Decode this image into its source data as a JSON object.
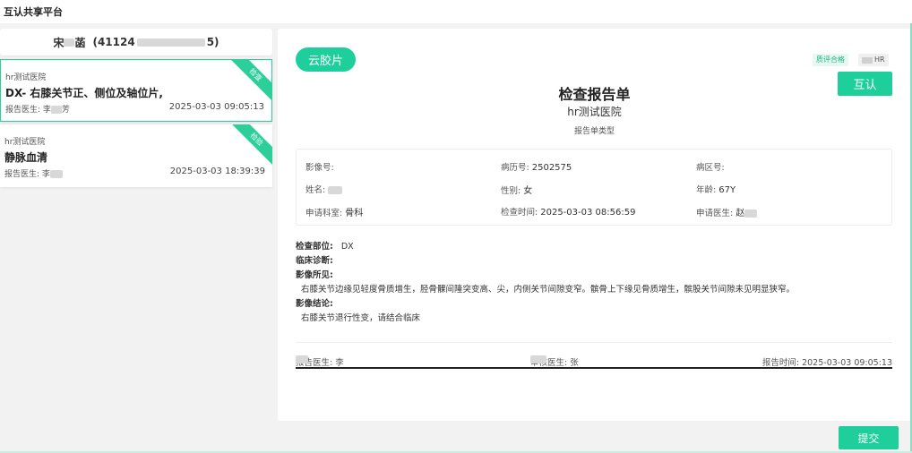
{
  "app": {
    "title": "互认共享平台"
  },
  "patient": {
    "name_prefix": "宋",
    "name_suffix": "菡",
    "id_prefix": "(41124",
    "id_suffix": "5)"
  },
  "cards": [
    {
      "hospital": "hr测试医院",
      "name": "DX- 右膝关节正、侧位及轴位片,",
      "doctor_label": "报告医生: 李",
      "doctor_suffix": "芳",
      "time": "2025-03-03 09:05:13",
      "badge": "检查"
    },
    {
      "hospital": "hr测试医院",
      "name": "静脉血清",
      "doctor_label": "报告医生: 李",
      "doctor_suffix": "",
      "time": "2025-03-03 18:39:39",
      "badge": "检验"
    }
  ],
  "report": {
    "film_button": "云胶片",
    "tag_pass": "质评合格",
    "tag_hr": "HR",
    "mutual_button": "互认",
    "title": "检查报告单",
    "hospital": "hr测试医院",
    "type": "报告单类型",
    "info": {
      "image_no": "影像号:",
      "record_no_label": "病历号:",
      "record_no": "2502575",
      "ward_no": "病区号:",
      "name_label": "姓名:",
      "gender_label": "性别:",
      "gender": "女",
      "age_label": "年龄:",
      "age": "67Y",
      "dept_label": "申请科室:",
      "dept": "骨科",
      "exam_time_label": "检查时间:",
      "exam_time": "2025-03-03 08:56:59",
      "req_doctor_label": "申请医生:",
      "req_doctor": "赵"
    },
    "findings": {
      "part_label": "检查部位:",
      "part": "DX",
      "clinical_label": "临床诊断:",
      "imaging_label": "影像所见:",
      "imaging": "右膝关节边缘见轻度骨质增生，胫骨髁间隆突变高、尖，内侧关节间隙变窄。髌骨上下缘见骨质增生，髌股关节间隙未见明显狭窄。",
      "conclusion_label": "影像结论:",
      "conclusion": "右膝关节退行性变，请结合临床"
    },
    "footer": {
      "report_doctor": "报告医生: 李",
      "audit_doctor": "审核医生: 张",
      "report_time": "报告时间: 2025-03-03 09:05:13"
    }
  },
  "submit_button": "提交"
}
